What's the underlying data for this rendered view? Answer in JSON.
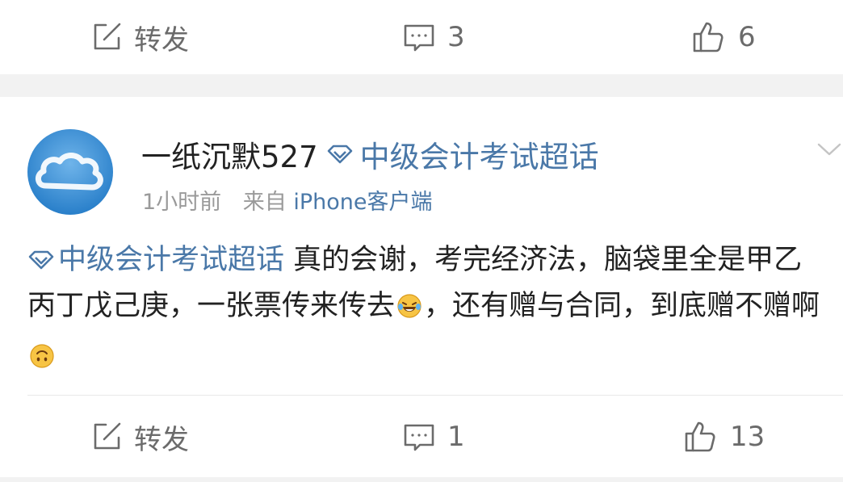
{
  "post1": {
    "actions": {
      "repost_label": "转发",
      "comment_count": "3",
      "like_count": "6"
    }
  },
  "post2": {
    "author": {
      "username": "一纸沉默527",
      "topic": "中级会计考试超话"
    },
    "meta": {
      "time": "1小时前",
      "from_prefix": "来自",
      "source": "iPhone客户端"
    },
    "content": {
      "topic": "中级会计考试超话",
      "text_part1": " 真的会谢，考完经济法，脑袋里全是甲乙丙丁戊己庚，一张票传来传去",
      "text_part2": "，还有赠与合同，到底赠不赠啊"
    },
    "actions": {
      "repost_label": "转发",
      "comment_count": "1",
      "like_count": "13"
    }
  },
  "colors": {
    "link_blue": "#4a78a8",
    "action_gray": "#6b6b6b",
    "meta_gray": "#9a9a9a",
    "background": "#f2f2f2"
  },
  "icons": [
    "repost-icon",
    "comment-icon",
    "like-icon",
    "supertopic-diamond-icon",
    "chevron-down-icon",
    "laughing-tears-emoji",
    "upside-down-face-emoji"
  ]
}
